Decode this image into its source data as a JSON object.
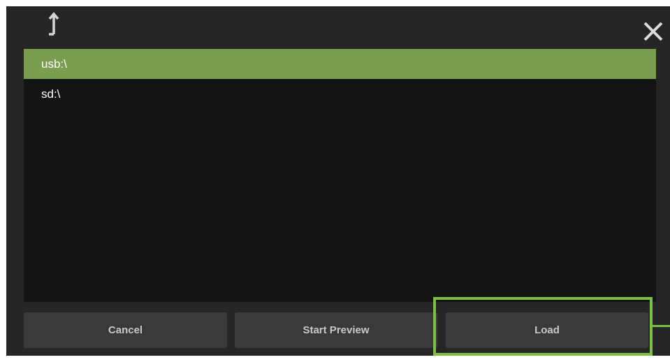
{
  "file_browser": {
    "items": [
      {
        "label": "usb:\\",
        "selected": true
      },
      {
        "label": "sd:\\",
        "selected": false
      }
    ]
  },
  "buttons": {
    "cancel": "Cancel",
    "start_preview": "Start Preview",
    "load": "Load"
  },
  "icons": {
    "up": "folder-up-icon",
    "close": "close-icon"
  },
  "colors": {
    "selected_row": "#7b9d50",
    "highlight": "#7ac143",
    "panel": "#262626",
    "list_background": "#141414"
  }
}
